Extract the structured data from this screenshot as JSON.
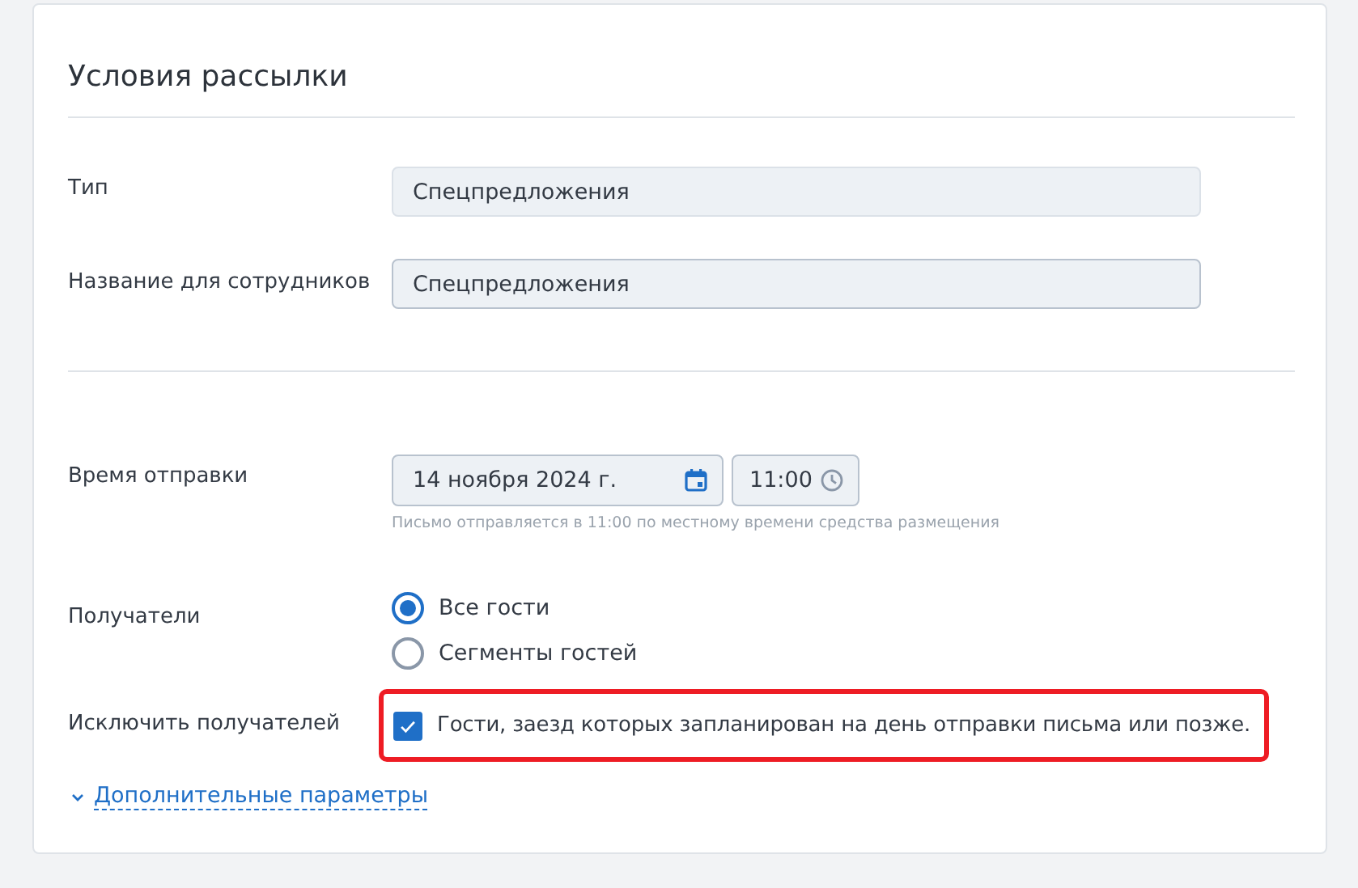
{
  "card": {
    "title": "Условия рассылки"
  },
  "type_field": {
    "label": "Тип",
    "value": "Спецпредложения",
    "disabled": true
  },
  "name_field": {
    "label": "Название для сотрудников",
    "value": "Спецпредложения",
    "disabled": false
  },
  "send_time": {
    "label": "Время отправки",
    "date": "14 ноября 2024 г.",
    "time": "11:00",
    "hint": "Письмо отправляется в 11:00 по местному времени средства размещения"
  },
  "recipients": {
    "label": "Получатели",
    "options": [
      {
        "label": "Все гости",
        "selected": true
      },
      {
        "label": "Сегменты гостей",
        "selected": false
      }
    ]
  },
  "exclude": {
    "label": "Исключить получателей",
    "option": {
      "label": "Гости, заезд которых запланирован на день отправки письма или позже.",
      "checked": true
    },
    "highlighted": true
  },
  "more_link": {
    "label": "Дополнительные параметры",
    "expanded": false
  }
}
